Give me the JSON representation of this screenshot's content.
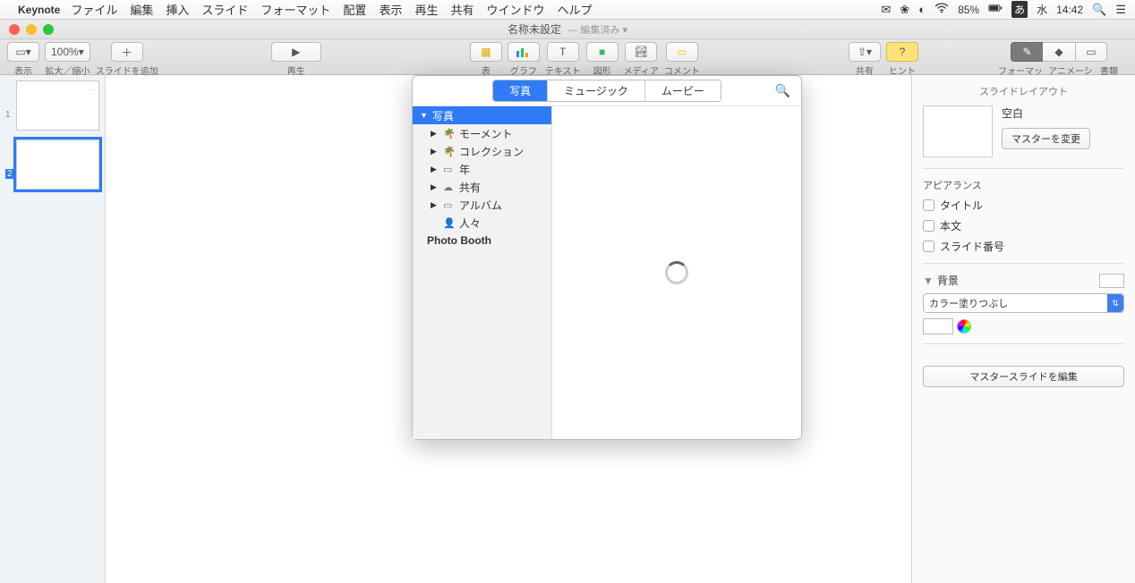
{
  "menubar": {
    "app": "Keynote",
    "items": [
      "ファイル",
      "編集",
      "挿入",
      "スライド",
      "フォーマット",
      "配置",
      "表示",
      "再生",
      "共有",
      "ウインドウ",
      "ヘルプ"
    ],
    "battery": "85%",
    "ime": "あ",
    "day": "水",
    "time": "14:42"
  },
  "titlebar": {
    "title": "名称未設定",
    "edited": "— 編集済み ▾"
  },
  "toolbar": {
    "view": "表示",
    "zoom_val": "100%",
    "zoom": "拡大／縮小",
    "add": "スライドを追加",
    "play": "再生",
    "table": "表",
    "chart": "グラフ",
    "text": "テキスト",
    "shape": "図形",
    "media": "メディア",
    "comment": "コメント",
    "share": "共有",
    "hint": "ヒント",
    "format": "フォーマット",
    "animate": "アニメーション",
    "document": "書類"
  },
  "inspector": {
    "title": "スライドレイアウト",
    "layout_name": "空白",
    "change_master": "マスターを変更",
    "appearance": "アピアランス",
    "chk_title": "タイトル",
    "chk_body": "本文",
    "chk_num": "スライド番号",
    "background": "背景",
    "fill_type": "カラー塗りつぶし",
    "edit_master": "マスタースライドを編集"
  },
  "popover": {
    "tabs": [
      "写真",
      "ミュージック",
      "ムービー"
    ],
    "root": "写真",
    "items": [
      "モーメント",
      "コレクション",
      "年",
      "共有",
      "アルバム",
      "人々"
    ],
    "photo_booth": "Photo Booth"
  }
}
